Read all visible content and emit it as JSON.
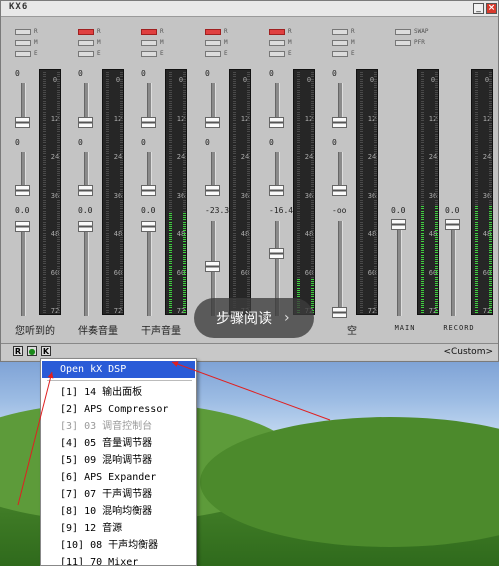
{
  "window": {
    "title": "KX6",
    "minimize_symbol": "_",
    "close_symbol": "×"
  },
  "routing_labels": [
    "R",
    "M",
    "E"
  ],
  "swap_labels": [
    "SWAP",
    "PFR"
  ],
  "channels": [
    {
      "name": "您听到的",
      "levels": [
        "0",
        "0",
        "0.0"
      ],
      "meter_fill": 0.0
    },
    {
      "name": "伴奏音量",
      "levels": [
        "0",
        "0",
        "0.0"
      ],
      "meter_fill": 0.0
    },
    {
      "name": "干声音量",
      "levels": [
        "0",
        "0",
        "0.0"
      ],
      "meter_fill": 0.42
    },
    {
      "name": "",
      "levels": [
        "0",
        "0",
        "-23.3"
      ],
      "meter_fill": 0.0
    },
    {
      "name": "",
      "levels": [
        "0",
        "0",
        "-16.4"
      ],
      "meter_fill": 0.15
    },
    {
      "name": "空",
      "levels": [
        "0",
        "0",
        "-oo"
      ],
      "meter_fill": 0.0
    }
  ],
  "master": {
    "main_label": "MAIN",
    "main_level": "0.0",
    "record_label": "RECORD",
    "record_level": "0.0"
  },
  "meter_scale": [
    "0",
    "12",
    "24",
    "36",
    "48",
    "60",
    "72"
  ],
  "bottom_bar": {
    "buttons": [
      "R",
      "●",
      "K"
    ],
    "preset": "<Custom>"
  },
  "overlay": {
    "label": "步骤阅读",
    "chevron": "›"
  },
  "colors": {
    "menu_highlight": "#2a5bd7",
    "meter_green": "#40d040",
    "led_red": "#e04040",
    "arrow_red": "#e02020"
  },
  "context_menu": {
    "items": [
      {
        "label": "Open kX DSP",
        "highlighted": true,
        "disabled": false
      },
      {
        "label": "[1] 14 输出面板",
        "highlighted": false,
        "disabled": false
      },
      {
        "label": "[2] APS Compressor",
        "highlighted": false,
        "disabled": false
      },
      {
        "label": "[3] 03 调音控制台",
        "highlighted": false,
        "disabled": true
      },
      {
        "label": "[4] 05 音量调节器",
        "highlighted": false,
        "disabled": false
      },
      {
        "label": "[5] 09 混响调节器",
        "highlighted": false,
        "disabled": false
      },
      {
        "label": "[6] APS Expander",
        "highlighted": false,
        "disabled": false
      },
      {
        "label": "[7] 07 干声调节器",
        "highlighted": false,
        "disabled": false
      },
      {
        "label": "[8] 10 混响均衡器",
        "highlighted": false,
        "disabled": false
      },
      {
        "label": "[9] 12 音源",
        "highlighted": false,
        "disabled": false
      },
      {
        "label": "[10] 08 干声均衡器",
        "highlighted": false,
        "disabled": false
      },
      {
        "label": "[11] 70 Mixer",
        "highlighted": false,
        "disabled": false
      }
    ]
  }
}
